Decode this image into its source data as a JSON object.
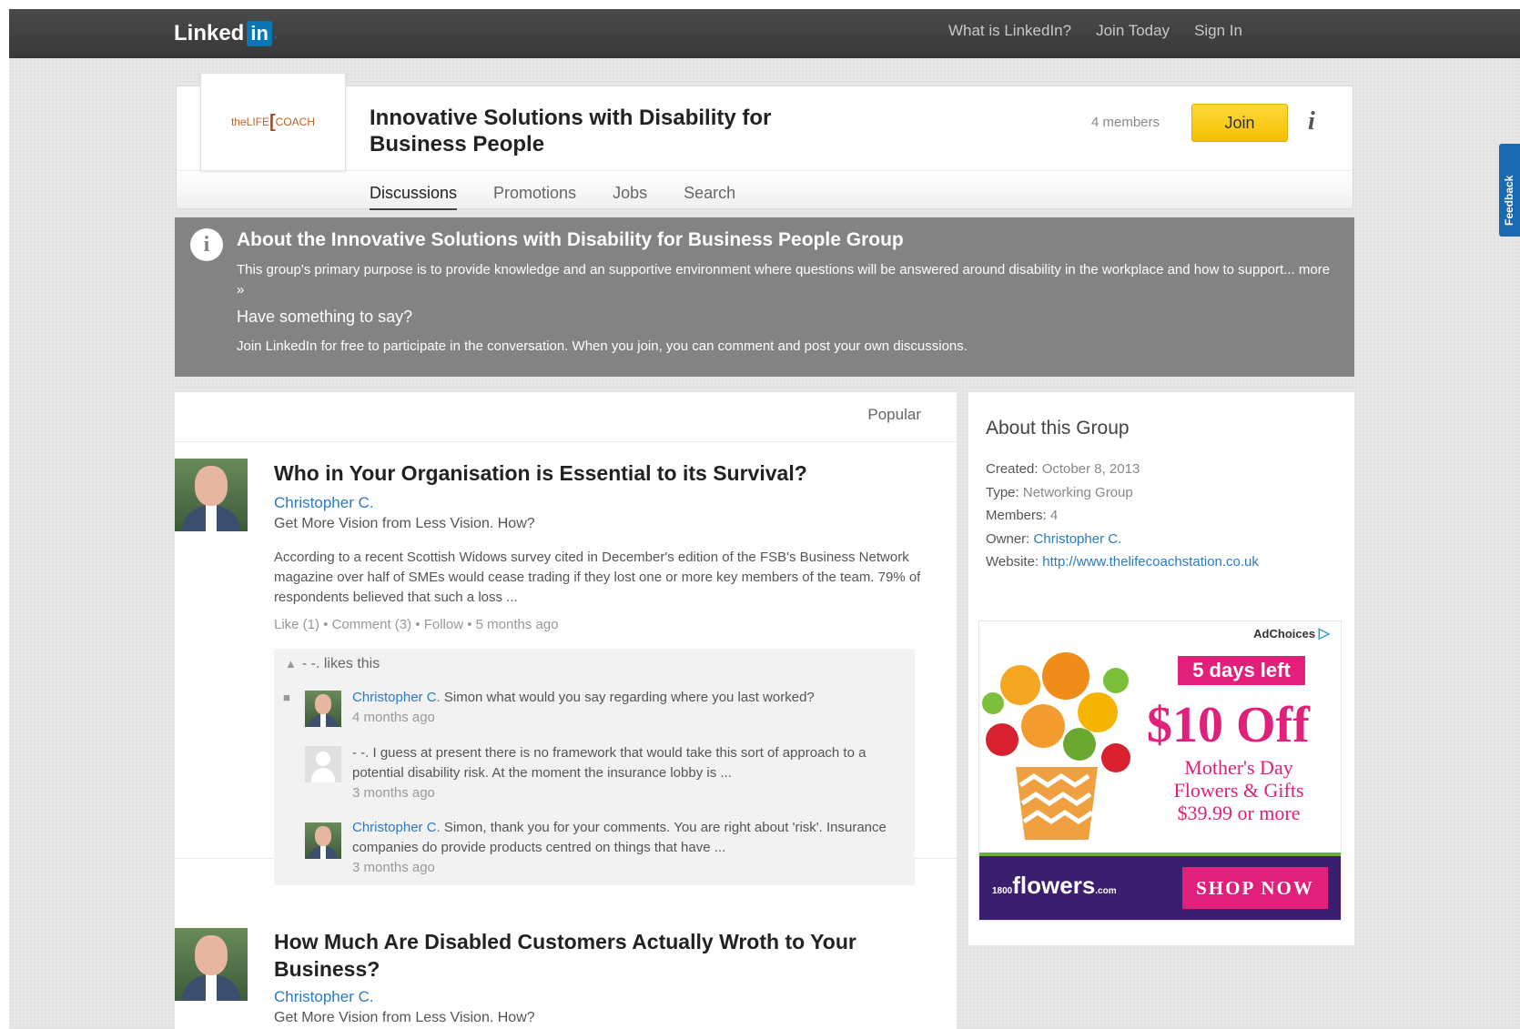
{
  "topbar": {
    "logo_text": "Linked",
    "logo_in": "in",
    "nav": [
      "What is LinkedIn?",
      "Join Today",
      "Sign In"
    ]
  },
  "group": {
    "logo_text": "theLIFE",
    "logo_coach": "COACH",
    "title": "Innovative Solutions with Disability for Business People",
    "members": "4 members",
    "join_label": "Join",
    "tabs": [
      "Discussions",
      "Promotions",
      "Jobs",
      "Search"
    ],
    "active_tab": "Discussions"
  },
  "feedback_label": "Feedback",
  "about_banner": {
    "title": "About the Innovative Solutions with Disability for Business People Group",
    "description": "This group's primary purpose is to provide knowledge and an supportive environment where questions will be answered around disability in the workplace and how to support...",
    "more_link": "more »",
    "say_heading": "Have something to say?",
    "join_text": "Join LinkedIn for free to participate in the conversation. When you join, you can comment and post your own discussions."
  },
  "discussions": {
    "sort_label": "Popular",
    "items": [
      {
        "title": "Who in Your Organisation is Essential to its Survival?",
        "author": "Christopher C.",
        "tagline": "Get More Vision from Less Vision. How?",
        "body": "According to a recent Scottish Widows survey cited in December's edition of the FSB's Business Network magazine over half of SMEs would cease trading if they lost one or more key members of the team. 79% of respondents believed that such a loss ...",
        "meta": "Like (1) • Comment (3) • Follow • 5 months ago",
        "likes": "- -. likes this",
        "comments": [
          {
            "name": "Christopher C.",
            "text": "Simon what would you say regarding where you last worked?",
            "time": "4 months ago"
          },
          {
            "name": "- -.",
            "text": "I guess at present there is no framework that would take this sort of approach to a potential disability risk. At the moment the insurance lobby is ...",
            "time": "3 months ago"
          },
          {
            "name": "Christopher C.",
            "text": "Simon, thank you for your comments. You are right about 'risk'. Insurance companies do provide products centred on things that have ...",
            "time": "3 months ago"
          }
        ]
      },
      {
        "title": "How Much Are Disabled Customers Actually Wroth to Your Business?",
        "author": "Christopher C.",
        "tagline": "Get More Vision from Less Vision. How?"
      }
    ]
  },
  "about_group": {
    "heading": "About this Group",
    "created_label": "Created:",
    "created_value": "October 8, 2013",
    "type_label": "Type:",
    "type_value": "Networking Group",
    "members_label": "Members:",
    "members_value": "4",
    "owner_label": "Owner:",
    "owner_value": "Christopher C.",
    "website_label": "Website:",
    "website_value": "http://www.thelifecoachstation.co.uk"
  },
  "ad": {
    "adchoices": "AdChoices",
    "days_left": "5 days left",
    "offer": "$10 Off",
    "line1": "Mother's Day",
    "line2": "Flowers & Gifts",
    "line3": "$39.99 or more",
    "brand": "flowers",
    "brand_prefix": "1800",
    "brand_suffix": ".com",
    "cta": "SHOP NOW",
    "colors": {
      "accent": "#e0207a",
      "brand_bg": "#3b1f6e"
    }
  }
}
